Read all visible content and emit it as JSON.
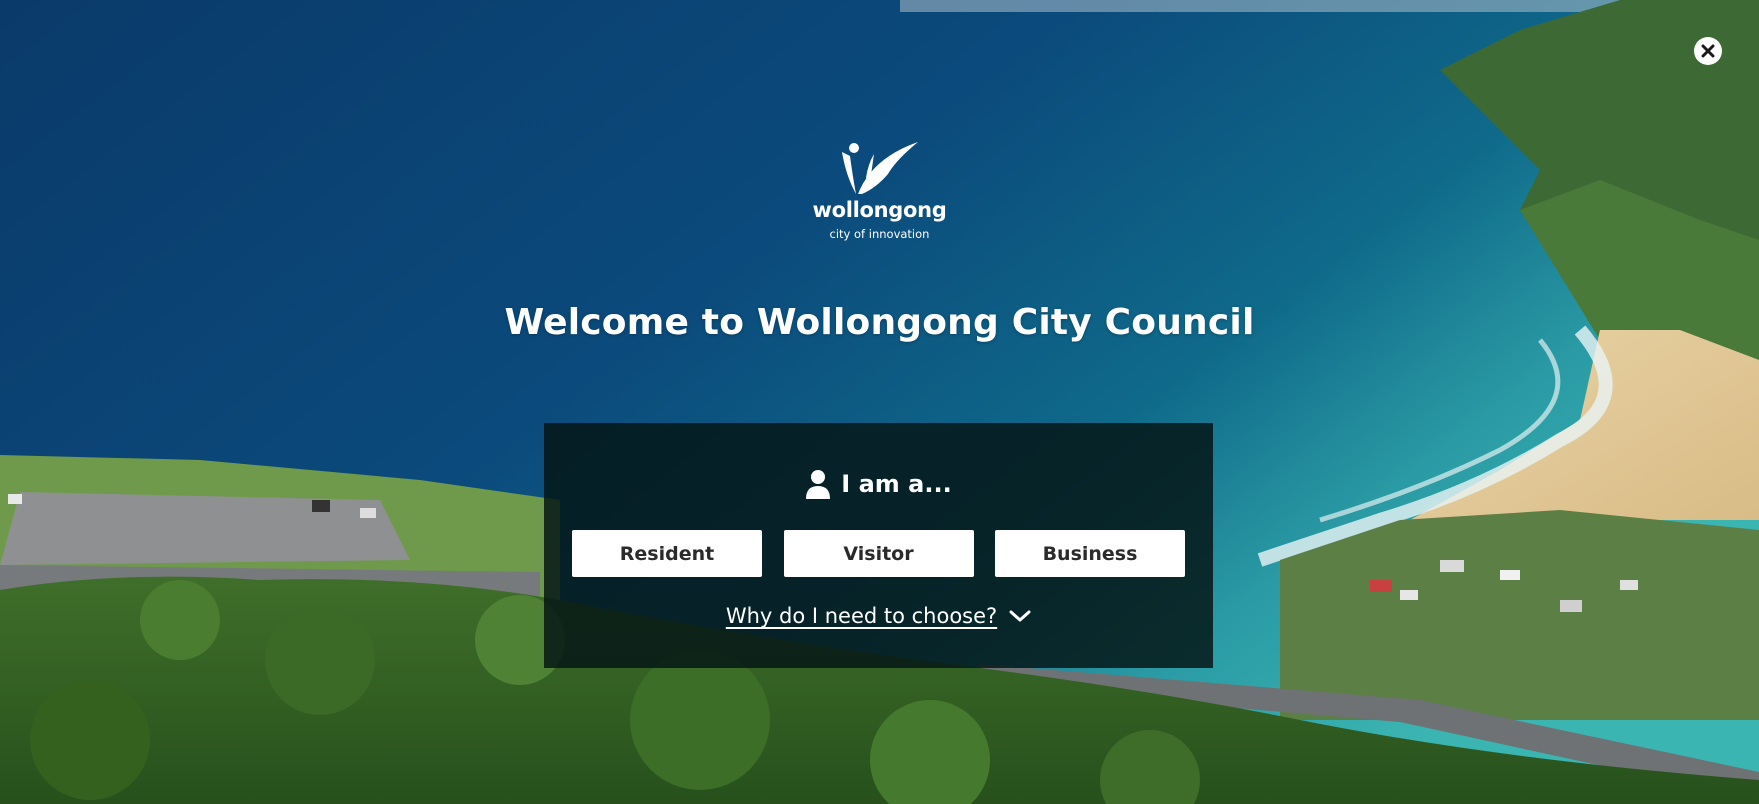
{
  "background": {
    "scene": "coastal-aerial-photo"
  },
  "close": {
    "icon": "close-icon"
  },
  "logo": {
    "wordmark": "wollongong",
    "tagline": "city of innovation"
  },
  "hero": {
    "title": "Welcome to Wollongong City Council"
  },
  "chooser": {
    "heading": "I am a...",
    "icon": "user-icon",
    "options": [
      {
        "label": "Resident"
      },
      {
        "label": "Visitor"
      },
      {
        "label": "Business"
      }
    ],
    "why_link": "Why do I need to choose?",
    "why_icon": "chevron-down-icon"
  },
  "colors": {
    "panel_bg": "#051616",
    "button_bg": "#ffffff",
    "button_text": "#2b2b2b",
    "text_light": "#ffffff"
  }
}
